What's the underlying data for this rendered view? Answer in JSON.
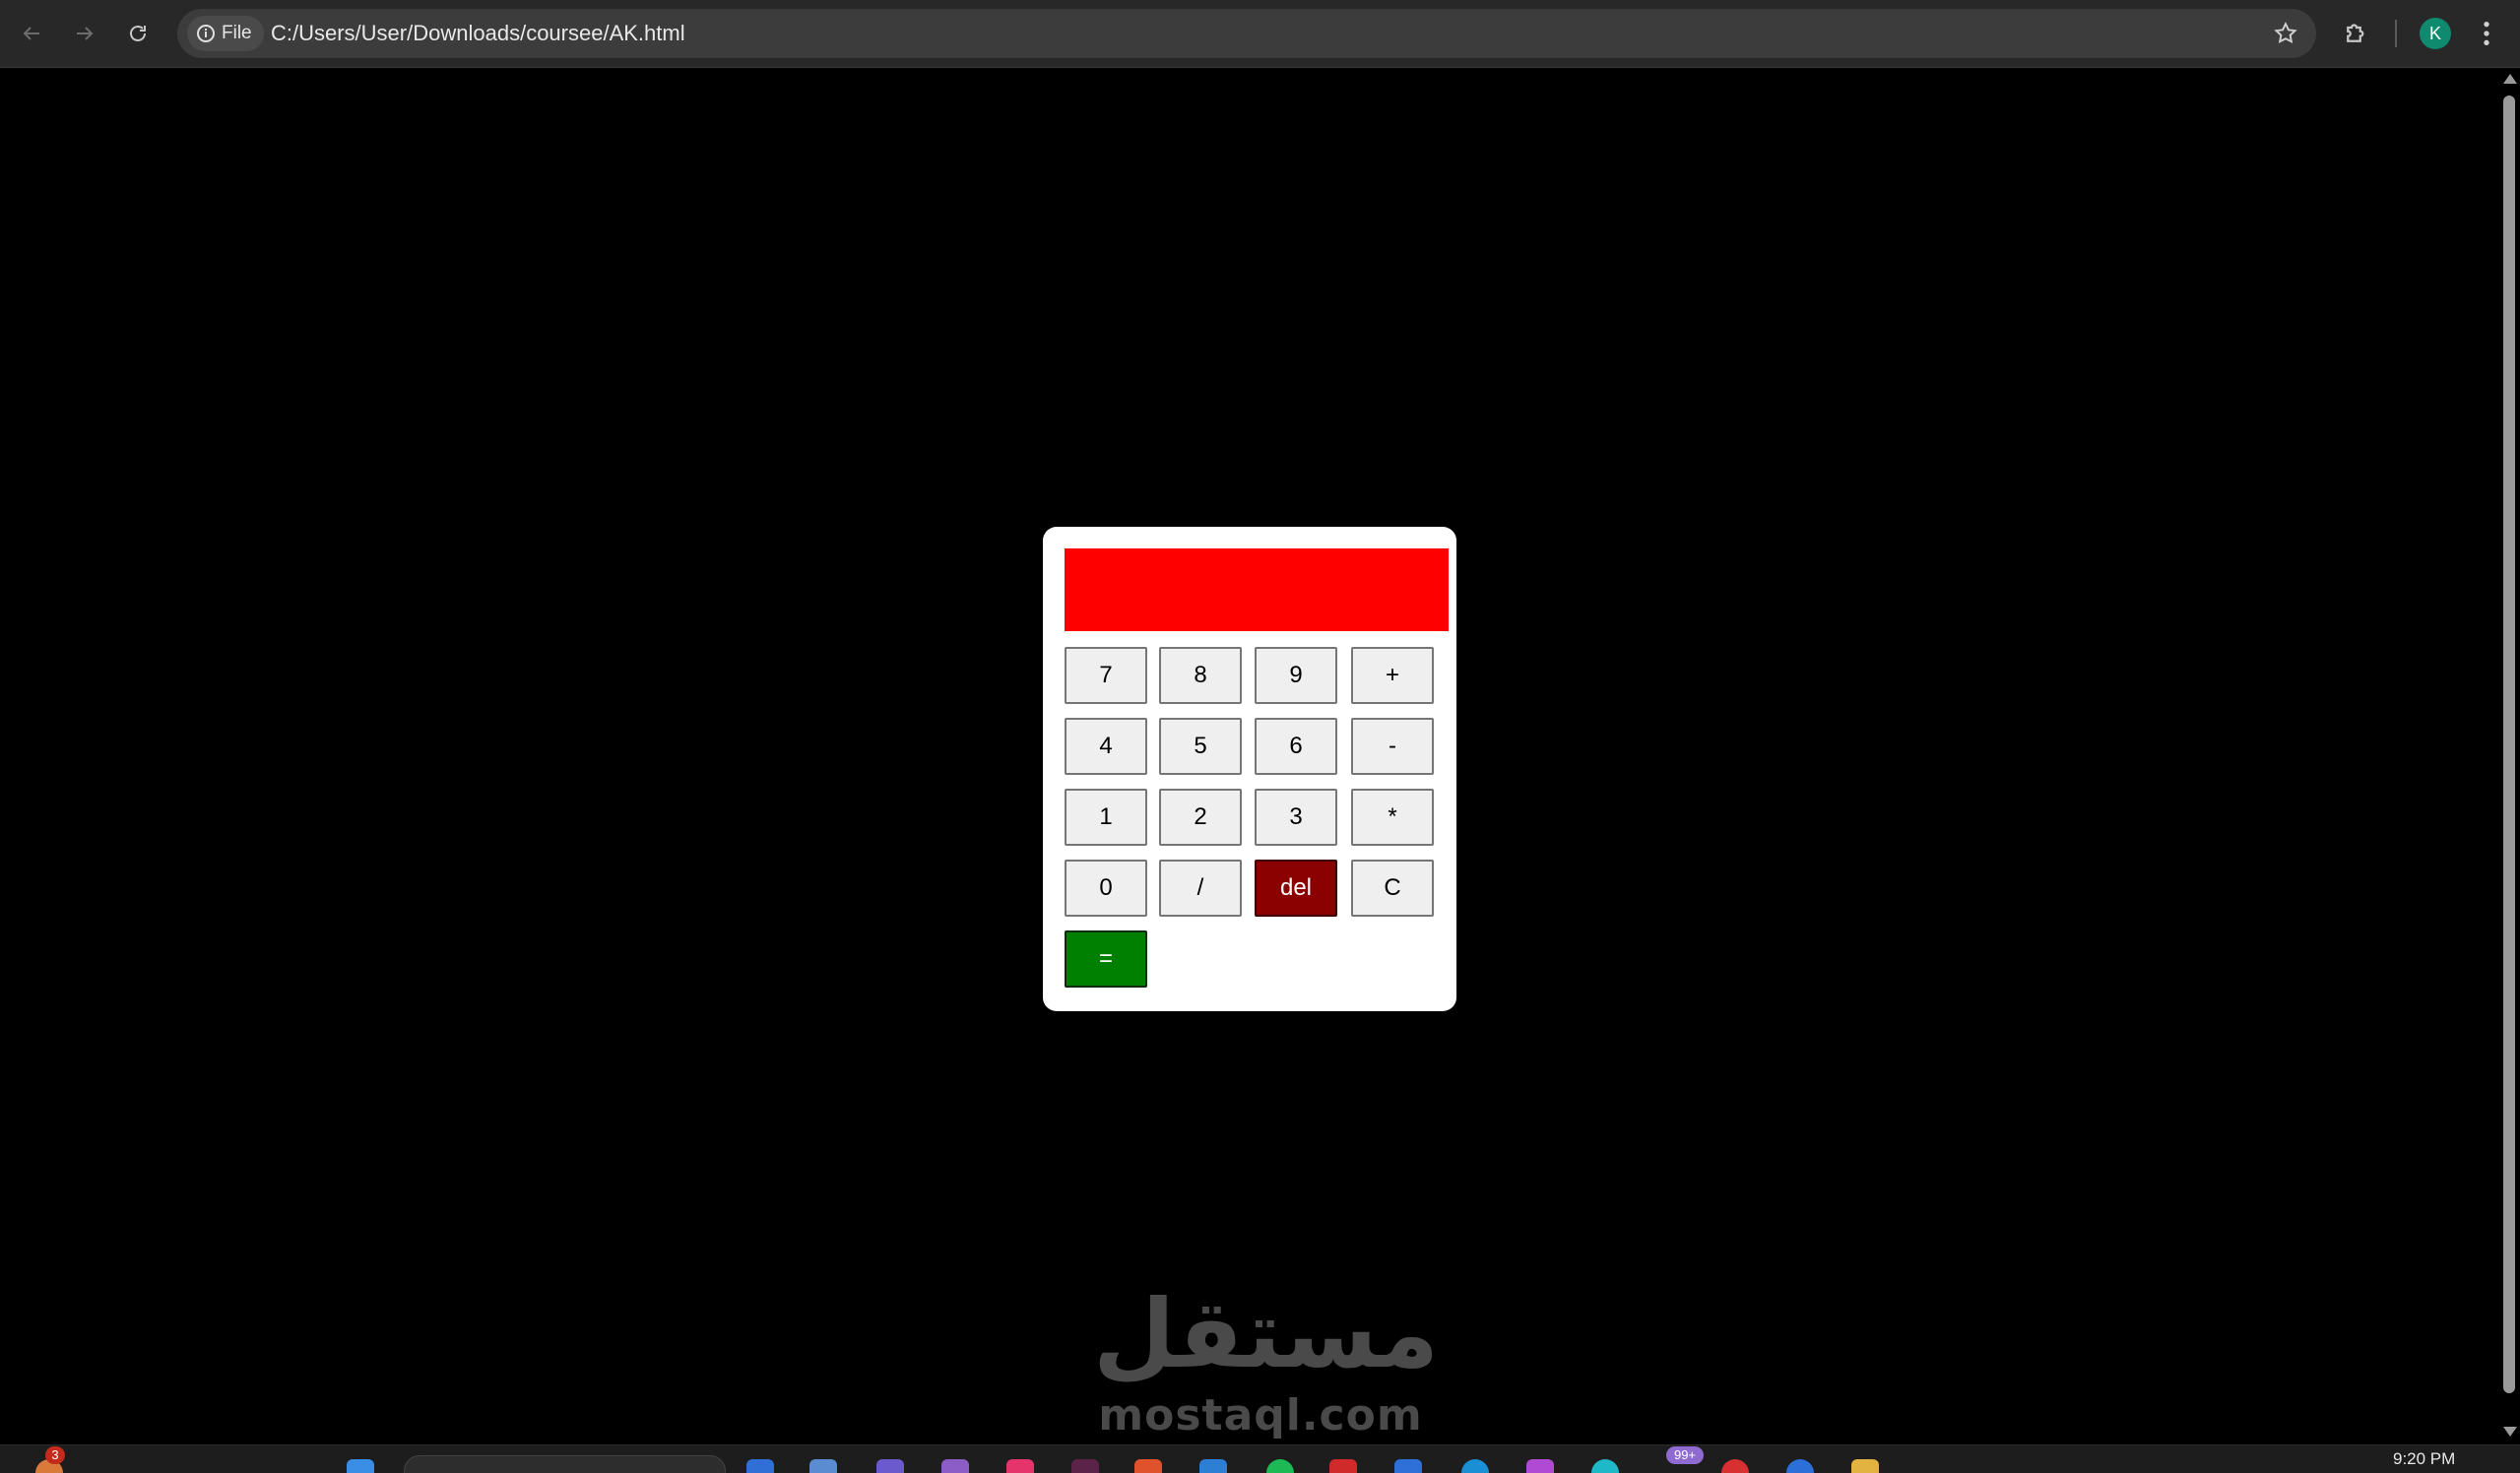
{
  "browser": {
    "site_chip_label": "File",
    "url": "C:/Users/User/Downloads/coursee/AK.html",
    "profile_initial": "K"
  },
  "calculator": {
    "display_value": "",
    "display_color": "#ff0000",
    "buttons": {
      "seven": "7",
      "eight": "8",
      "nine": "9",
      "plus": "+",
      "four": "4",
      "five": "5",
      "six": "6",
      "minus": "-",
      "one": "1",
      "two": "2",
      "three": "3",
      "multiply": "*",
      "zero": "0",
      "divide": "/",
      "del": "del",
      "clear": "C",
      "equals": "="
    },
    "del_color": "#8b0000",
    "equals_color": "#008000"
  },
  "watermark": {
    "arabic": "مستقل",
    "latin": "mostaql.com"
  },
  "taskbar": {
    "notification_badge": "3",
    "overflow_badge": "99+",
    "clock": "9:20 PM"
  }
}
